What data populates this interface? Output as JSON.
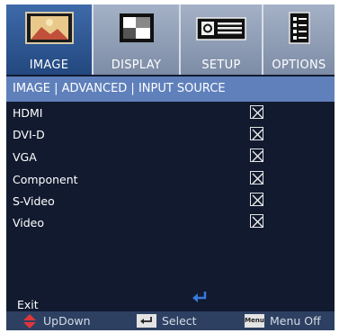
{
  "tabs": [
    {
      "label": "IMAGE",
      "icon": "image-icon",
      "active": true
    },
    {
      "label": "DISPLAY",
      "icon": "display-icon",
      "active": false
    },
    {
      "label": "SETUP",
      "icon": "setup-icon",
      "active": false
    },
    {
      "label": "OPTIONS",
      "icon": "options-icon",
      "active": false
    }
  ],
  "breadcrumb": "IMAGE | ADVANCED | INPUT SOURCE",
  "items": [
    {
      "label": "HDMI",
      "checked": true
    },
    {
      "label": "DVI-D",
      "checked": true
    },
    {
      "label": "VGA",
      "checked": true
    },
    {
      "label": "Component",
      "checked": true
    },
    {
      "label": "S-Video",
      "checked": true
    },
    {
      "label": "Video",
      "checked": true
    }
  ],
  "exit_label": "Exit",
  "footer": {
    "updown_label": "UpDown",
    "select_label": "Select",
    "menu_key": "Menu",
    "menu_label": "Menu Off"
  },
  "colors": {
    "accent_blue": "#3e6aa9",
    "titlebar": "#5f80bb",
    "background": "#111a2f",
    "enter_icon": "#3a78d8",
    "updown_icon": "#e0363a"
  }
}
